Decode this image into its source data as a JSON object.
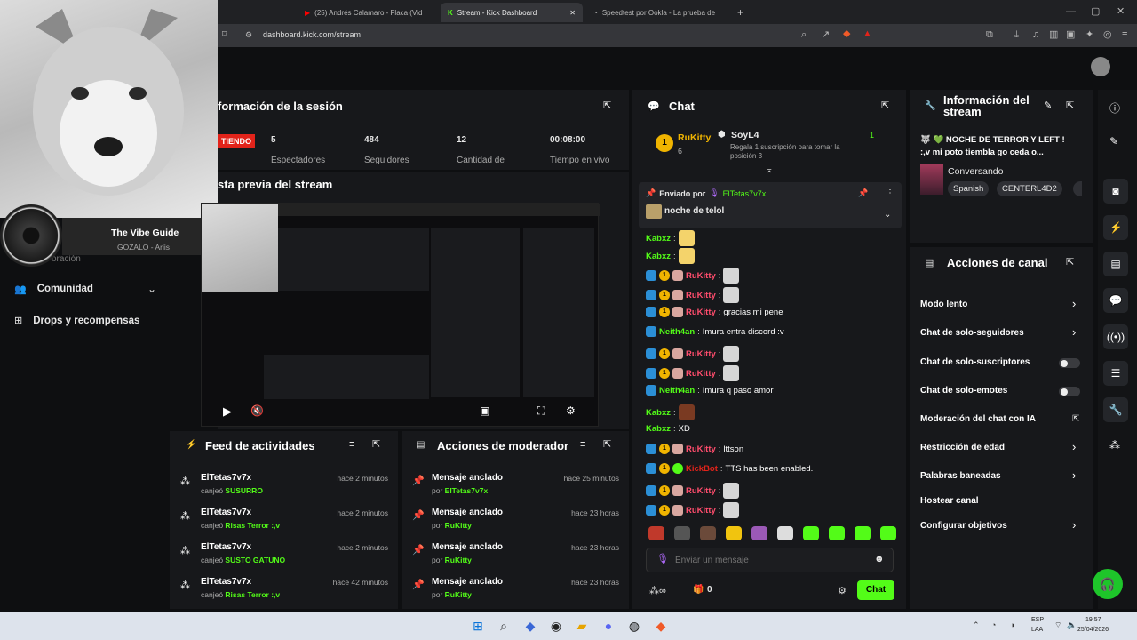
{
  "browser": {
    "tabs": [
      {
        "label": "(25) Andrés Calamaro - Flaca (Vid"
      },
      {
        "label": "Stream - Kick Dashboard"
      },
      {
        "label": "Speedtest por Ookla - La prueba de"
      }
    ],
    "url": "dashboard.kick.com/stream"
  },
  "overlay": {
    "name": "The Vibe Guide",
    "song": "GOZALO - Ariis"
  },
  "sidebar": {
    "partial": "oración",
    "items": [
      {
        "label": "Comunidad"
      },
      {
        "label": "Drops y recompensas"
      }
    ]
  },
  "session": {
    "title": "formación de la sesión",
    "live_badge": "TIENDO",
    "stats": [
      {
        "value": "5",
        "label": "Espectadores"
      },
      {
        "value": "484",
        "label": "Seguidores"
      },
      {
        "value": "12",
        "label": "Cantidad de"
      },
      {
        "value": "00:08:00",
        "label": "Tiempo en vivo"
      }
    ]
  },
  "preview": {
    "title": "sta previa del stream"
  },
  "feed": {
    "title": "Feed de actividades",
    "items": [
      {
        "user": "ElTetas7v7x",
        "action": "canjeó",
        "reward": "SUSURRO",
        "time": "hace 2 minutos"
      },
      {
        "user": "ElTetas7v7x",
        "action": "canjeó",
        "reward": "Risas Terror :,v",
        "time": "hace 2 minutos"
      },
      {
        "user": "ElTetas7v7x",
        "action": "canjeó",
        "reward": "SUSTO GATUNO",
        "time": "hace 2 minutos"
      },
      {
        "user": "ElTetas7v7x",
        "action": "canjeó",
        "reward": "Risas Terror :,v",
        "time": "hace 42 minutos"
      }
    ]
  },
  "modactions": {
    "title": "Acciones de moderador",
    "items": [
      {
        "action": "Mensaje anclado",
        "by": "por",
        "user": "ElTetas7v7x",
        "time": "hace 25 minutos"
      },
      {
        "action": "Mensaje anclado",
        "by": "por",
        "user": "RuKitty",
        "time": "hace 23 horas"
      },
      {
        "action": "Mensaje anclado",
        "by": "por",
        "user": "RuKitty",
        "time": "hace 23 horas"
      },
      {
        "action": "Mensaje anclado",
        "by": "por",
        "user": "RuKitty",
        "time": "hace 23 horas"
      }
    ]
  },
  "chat": {
    "title": "Chat",
    "top_gifter": {
      "rank": "1",
      "user": "RuKitty",
      "count": "6"
    },
    "second": {
      "user": "SoyL4",
      "desc": "Regala 1 suscripción para tomar la posición 3",
      "count": "1"
    },
    "pinned": {
      "sent_by": "Enviado por",
      "user": "ElTetas7v7x",
      "message": "noche de telol"
    },
    "messages": [
      {
        "user": "Kabxz",
        "text": "",
        "color": "#53fc18"
      },
      {
        "user": "Kabxz",
        "text": "",
        "color": "#53fc18"
      },
      {
        "user": "RuKitty",
        "text": "",
        "color": "#ff4d6d"
      },
      {
        "user": "RuKitty",
        "text": "",
        "color": "#ff4d6d"
      },
      {
        "user": "RuKitty",
        "text": "gracias mi pene",
        "color": "#ff4d6d"
      },
      {
        "user": "Neith4an",
        "text": "Imura entra discord :v",
        "color": "#53fc18"
      },
      {
        "user": "RuKitty",
        "text": "",
        "color": "#ff4d6d"
      },
      {
        "user": "RuKitty",
        "text": "",
        "color": "#ff4d6d"
      },
      {
        "user": "Neith4an",
        "text": "Imura q paso amor",
        "color": "#53fc18"
      },
      {
        "user": "Kabxz",
        "text": "",
        "color": "#53fc18"
      },
      {
        "user": "Kabxz",
        "text": "XD",
        "color": "#53fc18"
      },
      {
        "user": "RuKitty",
        "text": "lttson",
        "color": "#ff4d6d"
      },
      {
        "user": "KickBot",
        "text": "TTS has been enabled.",
        "color": "#e2231a"
      },
      {
        "user": "RuKitty",
        "text": "",
        "color": "#ff4d6d"
      },
      {
        "user": "RuKitty",
        "text": "",
        "color": "#ff4d6d"
      }
    ],
    "input_placeholder": "Enviar un mensaje",
    "points": "0",
    "send_label": "Chat"
  },
  "stream_info": {
    "title": "Información del stream",
    "stream_title": "🐺 💚 NOCHE DE TERROR Y LEFT ! :,v mi poto tiembla go ceda o...",
    "category": "Conversando",
    "tags": [
      "Spanish",
      "CENTERL4D2"
    ]
  },
  "channel_actions": {
    "title": "Acciones de canal",
    "items": [
      {
        "label": "Modo lento",
        "control": "chevron"
      },
      {
        "label": "Chat de solo-seguidores",
        "control": "chevron"
      },
      {
        "label": "Chat de solo-suscriptores",
        "control": "toggle"
      },
      {
        "label": "Chat de solo-emotes",
        "control": "toggle"
      },
      {
        "label": "Moderación del chat con IA",
        "control": "external"
      },
      {
        "label": "Restricción de edad",
        "control": "chevron"
      },
      {
        "label": "Palabras baneadas",
        "control": "chevron"
      },
      {
        "label": "Hostear canal",
        "control": "none"
      },
      {
        "label": "Configurar objetivos",
        "control": "chevron"
      }
    ]
  },
  "taskbar": {
    "lang": "ESP",
    "region": "LAA",
    "time": "19:57",
    "date": "25/04/2026"
  },
  "colors": {
    "kick_green": "#53fc18",
    "bg": "#0e0f11",
    "panel": "#17181b"
  }
}
